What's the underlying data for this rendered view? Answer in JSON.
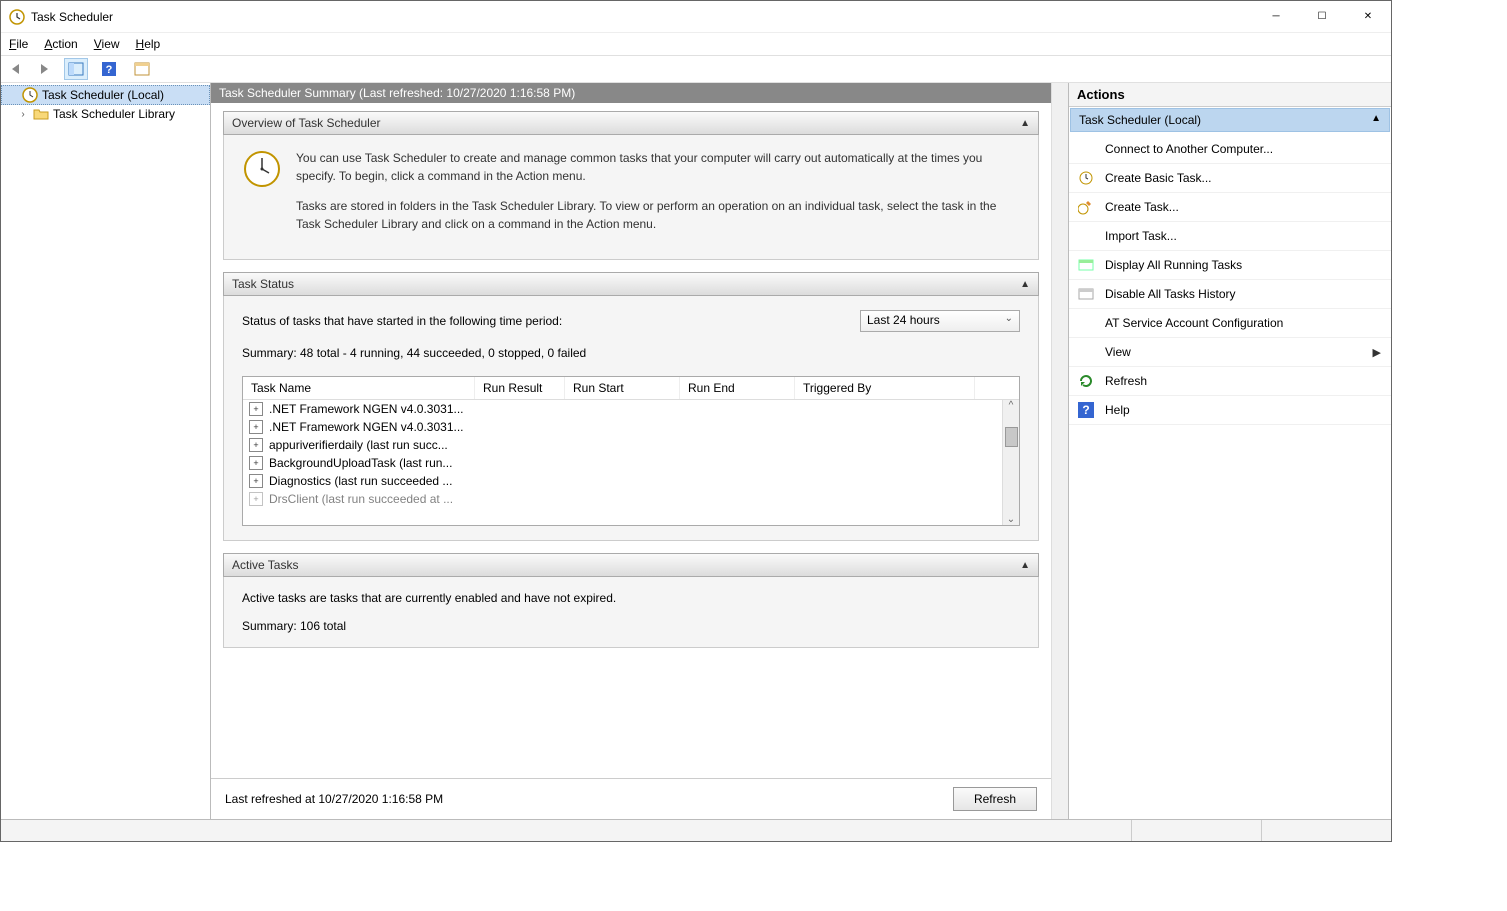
{
  "window": {
    "title": "Task Scheduler"
  },
  "menubar": {
    "file": "File",
    "action": "Action",
    "view": "View",
    "help": "Help"
  },
  "tree": {
    "root": "Task Scheduler (Local)",
    "child": "Task Scheduler Library"
  },
  "summary": {
    "title": "Task Scheduler Summary (Last refreshed: 10/27/2020 1:16:58 PM)",
    "overview_header": "Overview of Task Scheduler",
    "overview_p1": "You can use Task Scheduler to create and manage common tasks that your computer will carry out automatically at the times you specify. To begin, click a command in the Action menu.",
    "overview_p2": "Tasks are stored in folders in the Task Scheduler Library. To view or perform an operation on an individual task, select the task in the Task Scheduler Library and click on a command in the Action menu.",
    "status_header": "Task Status",
    "status_period_label": "Status of tasks that have started in the following time period:",
    "status_period_value": "Last 24 hours",
    "status_summary": "Summary: 48 total - 4 running, 44 succeeded, 0 stopped, 0 failed",
    "table": {
      "cols": {
        "name": "Task Name",
        "result": "Run Result",
        "start": "Run Start",
        "end": "Run End",
        "trigger": "Triggered By"
      },
      "rows": [
        ".NET Framework NGEN v4.0.3031...",
        ".NET Framework NGEN v4.0.3031...",
        "appuriverifierdaily (last run succ...",
        "BackgroundUploadTask (last run...",
        "Diagnostics (last run succeeded ...",
        "DrsClient (last run succeeded at ..."
      ]
    },
    "active_header": "Active Tasks",
    "active_desc": "Active tasks are tasks that are currently enabled and have not expired.",
    "active_summary": "Summary: 106 total",
    "footer_text": "Last refreshed at 10/27/2020 1:16:58 PM",
    "refresh_btn": "Refresh"
  },
  "actions": {
    "header": "Actions",
    "section": "Task Scheduler (Local)",
    "items": [
      {
        "icon": "",
        "label": "Connect to Another Computer..."
      },
      {
        "icon": "basic",
        "label": "Create Basic Task..."
      },
      {
        "icon": "create",
        "label": "Create Task..."
      },
      {
        "icon": "",
        "label": "Import Task..."
      },
      {
        "icon": "display",
        "label": "Display All Running Tasks"
      },
      {
        "icon": "disable",
        "label": "Disable All Tasks History"
      },
      {
        "icon": "",
        "label": "AT Service Account Configuration"
      },
      {
        "icon": "",
        "label": "View",
        "sub": true
      },
      {
        "icon": "refresh",
        "label": "Refresh"
      },
      {
        "icon": "help",
        "label": "Help"
      }
    ]
  }
}
